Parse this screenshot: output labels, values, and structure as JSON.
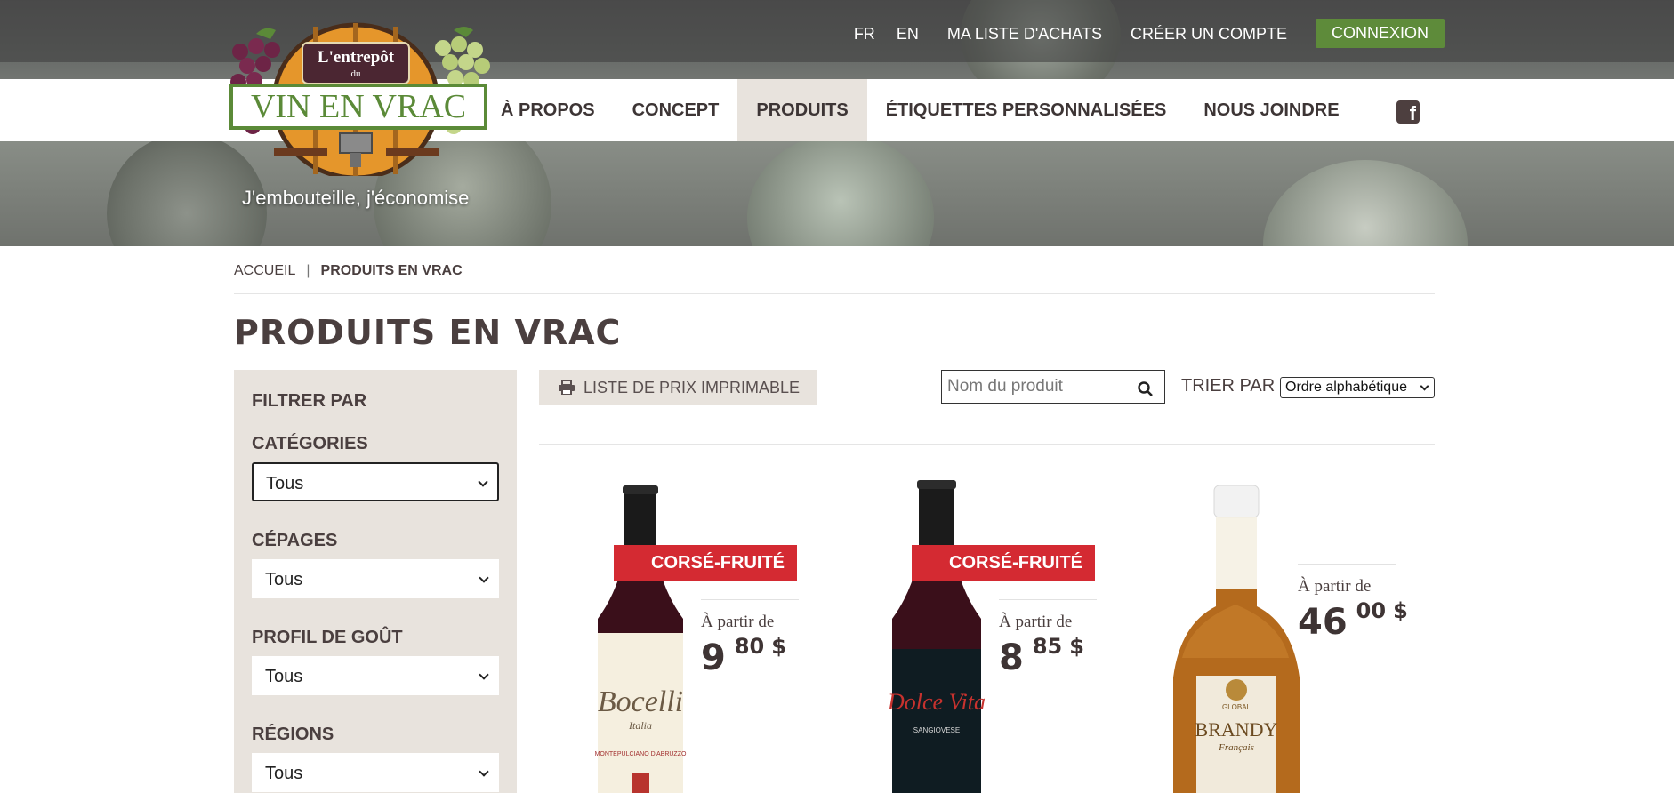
{
  "header": {
    "top_links": {
      "fr": "FR",
      "en": "EN",
      "shopping_list": "MA LISTE D'ACHATS",
      "create_account": "CRÉER UN COMPTE",
      "login": "CONNEXION"
    },
    "nav": [
      "À PROPOS",
      "CONCEPT",
      "PRODUITS",
      "ÉTIQUETTES PERSONNALISÉES",
      "NOUS JOINDRE"
    ],
    "active_nav": "PRODUITS",
    "logo": {
      "line1": "L'entrepôt",
      "line2": "du",
      "line3": "VIN EN VRAC"
    },
    "tagline": "J'embouteille, j'économise"
  },
  "breadcrumb": {
    "home": "ACCUEIL",
    "separator": "|",
    "current": "PRODUITS EN VRAC"
  },
  "page_title": "PRODUITS EN VRAC",
  "sidebar": {
    "title": "FILTRER PAR",
    "filters": [
      {
        "label": "CATÉGORIES",
        "value": "Tous"
      },
      {
        "label": "CÉPAGES",
        "value": "Tous"
      },
      {
        "label": "PROFIL DE GOÛT",
        "value": "Tous"
      },
      {
        "label": "RÉGIONS",
        "value": "Tous"
      }
    ]
  },
  "toolbar": {
    "print_label": "LISTE DE PRIX IMPRIMABLE",
    "search_placeholder": "Nom du produit",
    "sort_label": "TRIER PAR",
    "sort_value": "Ordre alphabétique"
  },
  "products": [
    {
      "badge": "CORSÉ-FRUITÉ",
      "from_label": "À partir de",
      "price_int": "9",
      "price_dec": "80",
      "currency": "$",
      "bottle_label": "Bocelli",
      "bottle_sub": "Italia",
      "bottle_detail": "MONTEPULCIANO D'ABRUZZO"
    },
    {
      "badge": "CORSÉ-FRUITÉ",
      "from_label": "À partir de",
      "price_int": "8",
      "price_dec": "85",
      "currency": "$",
      "bottle_label": "Dolce Vita",
      "bottle_detail": "SANGIOVESE"
    },
    {
      "from_label": "À partir de",
      "price_int": "46",
      "price_dec": "00",
      "currency": "$",
      "bottle_label": "BRANDY",
      "bottle_sub": "Français",
      "bottle_brand": "GLOBAL"
    }
  ],
  "colors": {
    "accent_green": "#5e8b3a",
    "badge_red": "#d42a32",
    "panel_beige": "#e8e3dd",
    "text_dark": "#4a3f3f"
  },
  "icons": [
    "facebook-icon",
    "print-icon",
    "search-icon",
    "chevron-down-icon"
  ]
}
